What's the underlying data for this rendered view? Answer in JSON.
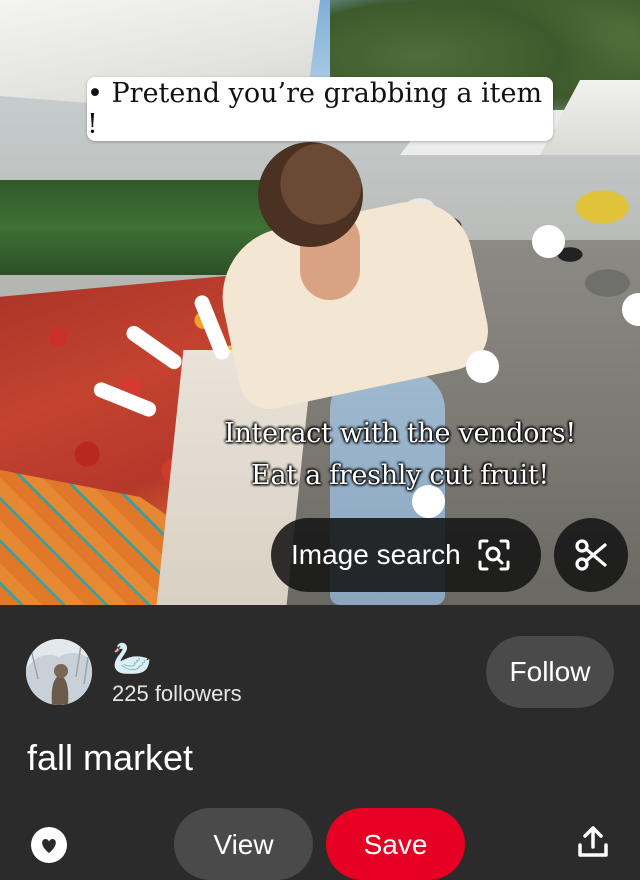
{
  "pin_image": {
    "caption_bubble": "• Pretend you’re grabbing a item !",
    "overlay_line1": "Interact with the vendors!",
    "overlay_line2": "Eat a freshly cut fruit!"
  },
  "image_search": {
    "label": "Image search",
    "icon": "image-search-icon"
  },
  "crop_button": {
    "icon": "scissors-icon"
  },
  "creator": {
    "name_emoji": "🦢",
    "followers": "225 followers",
    "follow_label": "Follow"
  },
  "board_title": "fall market",
  "actions": {
    "like_icon": "heart-icon",
    "view_label": "View",
    "save_label": "Save",
    "share_icon": "share-icon"
  },
  "colors": {
    "background": "#2b2b2b",
    "save": "#e60023",
    "secondary_button": "#4a4a4a"
  }
}
